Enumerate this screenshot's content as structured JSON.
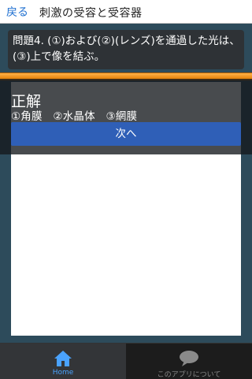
{
  "header": {
    "back_label": "戻る",
    "title": "刺激の受容と受容器"
  },
  "question": {
    "text": "問題4. (①)および(②)(レンズ)を通過した光は、(③)上で像を結ぶ。"
  },
  "result": {
    "title": "正解",
    "answer": "①角膜　②水晶体　③網膜",
    "next_label": "次へ"
  },
  "tabs": [
    {
      "label": "Home",
      "icon": "home-icon",
      "active": true
    },
    {
      "label": "このアプリについて",
      "icon": "chat-bubble-icon",
      "active": false
    }
  ],
  "colors": {
    "accent": "#2f5fb7",
    "back_link": "#1e6fd0",
    "orange_bar": "#f29a1c",
    "panel_bg": "#2d4b5b"
  }
}
